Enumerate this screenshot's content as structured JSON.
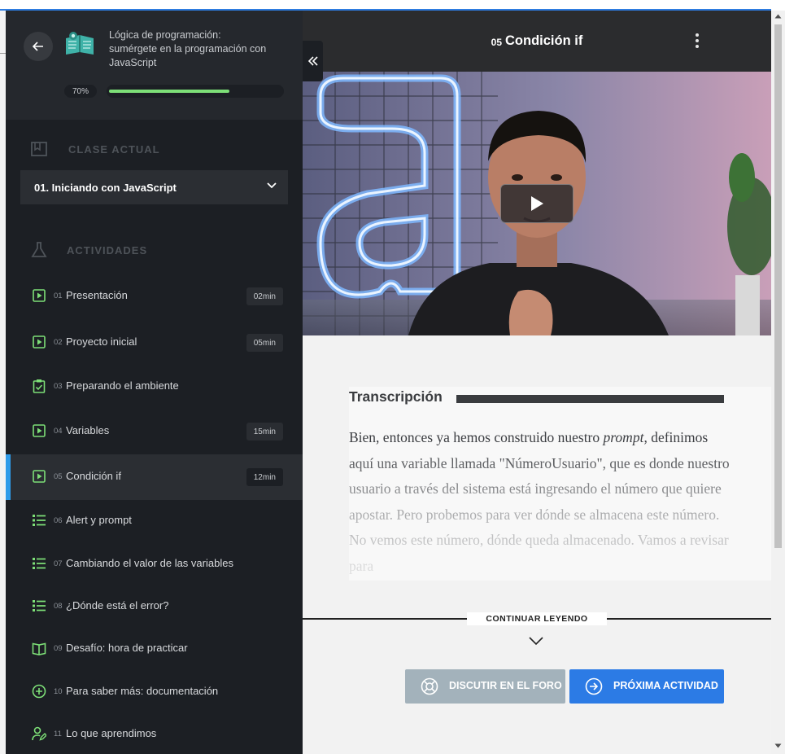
{
  "course": {
    "title": "Lógica de programación: sumérgete en la programación con JavaScript",
    "progress_label": "70%",
    "progress": 0.7
  },
  "sidebar": {
    "current_class_label": "CLASE ACTUAL",
    "current_class": "01. Iniciando con JavaScript",
    "activities_label": "ACTIVIDADES",
    "activities": [
      {
        "num": "01",
        "title": "Presentación",
        "duration": "02min",
        "icon": "video-icon"
      },
      {
        "num": "02",
        "title": "Proyecto inicial",
        "duration": "05min",
        "icon": "video-icon"
      },
      {
        "num": "03",
        "title": "Preparando el ambiente",
        "duration": "",
        "icon": "clipboard-check-icon"
      },
      {
        "num": "04",
        "title": "Variables",
        "duration": "15min",
        "icon": "video-icon"
      },
      {
        "num": "05",
        "title": "Condición if",
        "duration": "12min",
        "icon": "video-icon",
        "active": true
      },
      {
        "num": "06",
        "title": "Alert y prompt",
        "duration": "",
        "icon": "list-icon"
      },
      {
        "num": "07",
        "title": "Cambiando el valor de las variables",
        "duration": "",
        "icon": "list-icon"
      },
      {
        "num": "08",
        "title": "¿Dónde está el error?",
        "duration": "",
        "icon": "list-icon"
      },
      {
        "num": "09",
        "title": "Desafío: hora de practicar",
        "duration": "",
        "icon": "book-open-icon"
      },
      {
        "num": "10",
        "title": "Para saber más: documentación",
        "duration": "",
        "icon": "plus-circle-icon"
      },
      {
        "num": "11",
        "title": "Lo que aprendimos",
        "duration": "",
        "icon": "user-edit-icon"
      }
    ]
  },
  "video": {
    "number": "05",
    "title": "Condición if"
  },
  "transcript": {
    "heading": "Transcripción",
    "text_before": "Bien, entonces ya hemos construido nuestro ",
    "text_italic": "prompt",
    "text_after": ", definimos aquí una variable llamada \"NúmeroUsuario\", que es donde nuestro usuario a través del sistema está ingresando el número que quiere apostar. Pero probemos para ver dónde se almacena este número. No vemos este número, dónde queda almacenado. Vamos a revisar para"
  },
  "continue_label": "CONTINUAR LEYENDO",
  "buttons": {
    "forum": "DISCUTIR EN EL FORO",
    "next": "PRÓXIMA ACTIVIDAD"
  },
  "colors": {
    "accent_green": "#7ddf77",
    "accent_blue": "#2c7be5",
    "active_marker": "#2e9be9",
    "sidebar_bg": "#1c1f24"
  }
}
